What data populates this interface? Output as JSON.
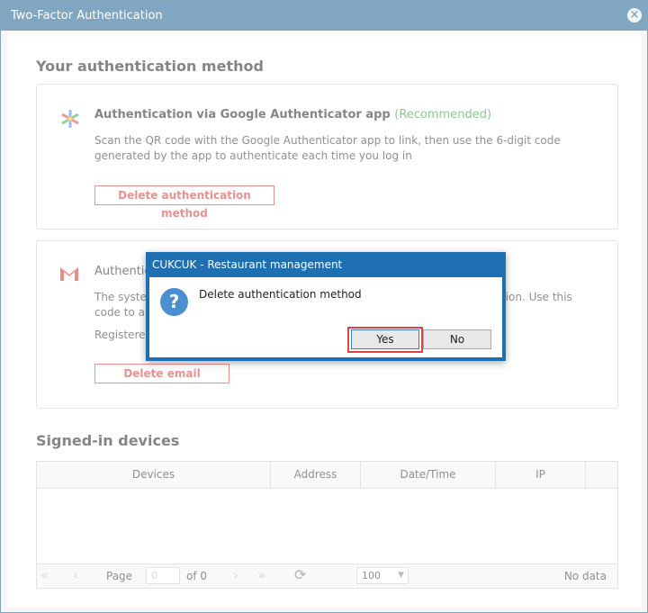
{
  "window": {
    "title": "Two-Factor Authentication"
  },
  "auth_section": {
    "heading": "Your authentication method",
    "google": {
      "title": "Authentication via Google Authenticator app",
      "recommended": "(Recommended)",
      "desc_line1": "Scan the QR code with the Google Authenticator app to link, then use the 6-digit code",
      "desc_line2": "generated by the app to authenticate each time you log in",
      "delete_label": "Delete authentication method"
    },
    "email": {
      "title": "Authentica",
      "desc_line1_left": "The system",
      "desc_line1_right": "tication. Use this",
      "desc_line2": "code to au",
      "registered": "Registered",
      "delete_label": "Delete email"
    }
  },
  "devices": {
    "heading": "Signed-in devices",
    "columns": [
      "Devices",
      "Address",
      "Date/Time",
      "IP"
    ],
    "pager": {
      "page_label": "Page",
      "page_value": "0",
      "of_label": "of 0",
      "page_size": "100",
      "status": "No data"
    }
  },
  "dialog": {
    "title": "CUKCUK - Restaurant management",
    "message": "Delete authentication method",
    "yes_label": "Yes",
    "no_label": "No"
  },
  "colors": {
    "titlebar": "#1a5e91",
    "danger": "#d33333",
    "recommended": "#2e9a3e",
    "dialog_border": "#1f6fb3"
  }
}
